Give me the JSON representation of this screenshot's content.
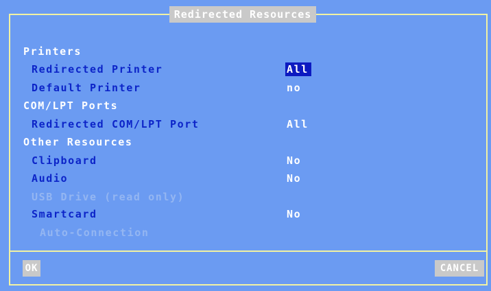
{
  "dialog": {
    "title": "Redirected Resources"
  },
  "sections": {
    "printers": {
      "label": "Printers",
      "redirected_printer": {
        "label": "Redirected Printer",
        "value": "All"
      },
      "default_printer": {
        "label": "Default Printer",
        "value": "no"
      }
    },
    "ports": {
      "label": "COM/LPT Ports",
      "redirected_port": {
        "label": "Redirected COM/LPT Port",
        "value": "All"
      }
    },
    "other": {
      "label": "Other Resources",
      "clipboard": {
        "label": "Clipboard",
        "value": "No"
      },
      "audio": {
        "label": "Audio",
        "value": "No"
      },
      "usb_drive": {
        "label": "USB Drive (read only)"
      },
      "smartcard": {
        "label": "Smartcard",
        "value": "No"
      },
      "auto_connection": {
        "label": "Auto-Connection"
      }
    }
  },
  "buttons": {
    "ok": "OK",
    "cancel": "CANCEL"
  },
  "colors": {
    "background": "#6b9bf2",
    "frame_border": "#f2f2a2",
    "title_bar": "#c9c9c9",
    "item_text": "#0c24c8",
    "disabled_text": "#94b6f2",
    "selection": "#0c1ac0"
  }
}
